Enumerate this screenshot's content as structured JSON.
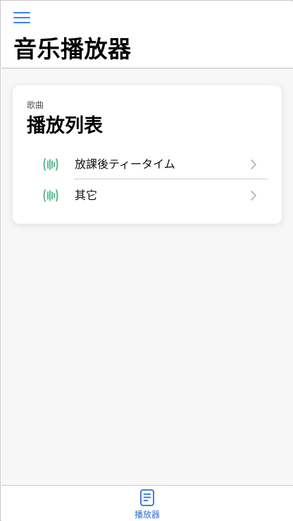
{
  "app": {
    "title": "音乐播放器"
  },
  "colors": {
    "accent": "#3b82f6",
    "song_icon": "#3aaa7c",
    "chevron": "#b5b5b5"
  },
  "header": {
    "menu_icon": "hamburger-menu-icon"
  },
  "card": {
    "overline": "歌曲",
    "title": "播放列表",
    "items": [
      {
        "label": "放課後ティータイム",
        "icon": "audio-waveform-icon"
      },
      {
        "label": "其它",
        "icon": "audio-waveform-icon"
      }
    ]
  },
  "tabbar": {
    "tabs": [
      {
        "label": "播放器",
        "icon": "document-icon",
        "active": true
      }
    ]
  }
}
